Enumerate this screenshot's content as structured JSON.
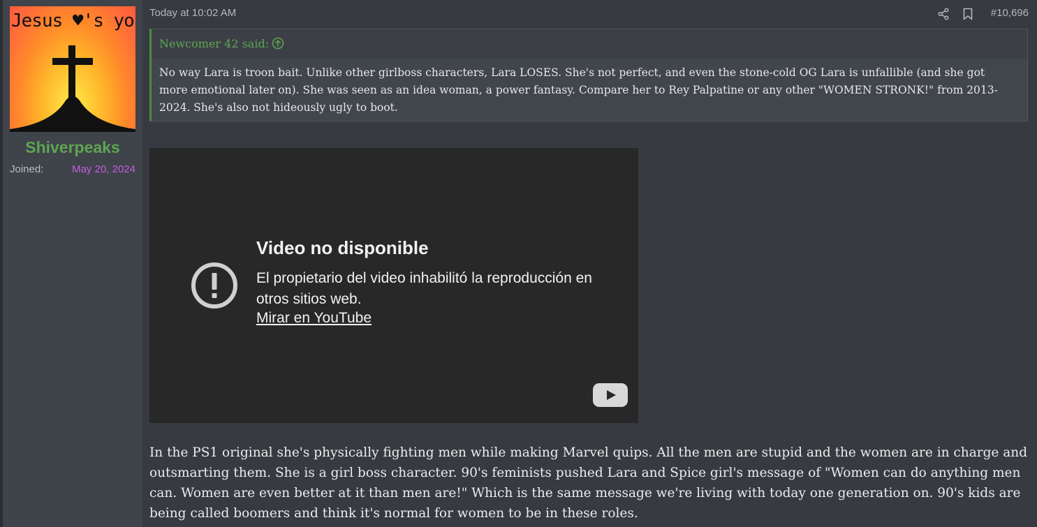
{
  "user": {
    "avatar_text": "Jesus ♥'s you",
    "username": "Shiverpeaks",
    "joined_label": "Joined:",
    "joined_date": "May 20, 2024"
  },
  "post": {
    "time": "Today at 10:02 AM",
    "number": "#10,696",
    "icons": [
      "share-icon",
      "bookmark-icon"
    ]
  },
  "quote": {
    "author": "Newcomer 42 said:",
    "text": "No way Lara is troon bait. Unlike other girlboss characters, Lara LOSES. She's not perfect, and even the stone-cold OG Lara is unfallible (and she got more emotional later on). She was seen as an idea woman, a power fantasy. Compare her to Rey Palpatine or any other \"WOMEN STRONK!\" from 2013-2024. She's also not hideously ugly to boot."
  },
  "video": {
    "title": "Video no disponible",
    "message": "El propietario del video inhabilitó la reproducción en otros sitios web.",
    "link": "Mirar en YouTube"
  },
  "body": {
    "text": "In the PS1 original she's physically fighting men while making Marvel quips. All the men are stupid and the women are in charge and outsmarting them. She is a girl boss character. 90's feminists pushed Lara and Spice girl's message of \"Women can do anything men can. Women are even better at it than men are!\" Which is the same message we're living with today one generation on. 90's kids are being called boomers and think it's normal for women to be in these roles."
  },
  "colors": {
    "background": "#373a40",
    "sidebar": "#3f434a",
    "username": "#5ea552",
    "joined_date": "#c55ee0",
    "quote_border": "#4e8a48"
  }
}
